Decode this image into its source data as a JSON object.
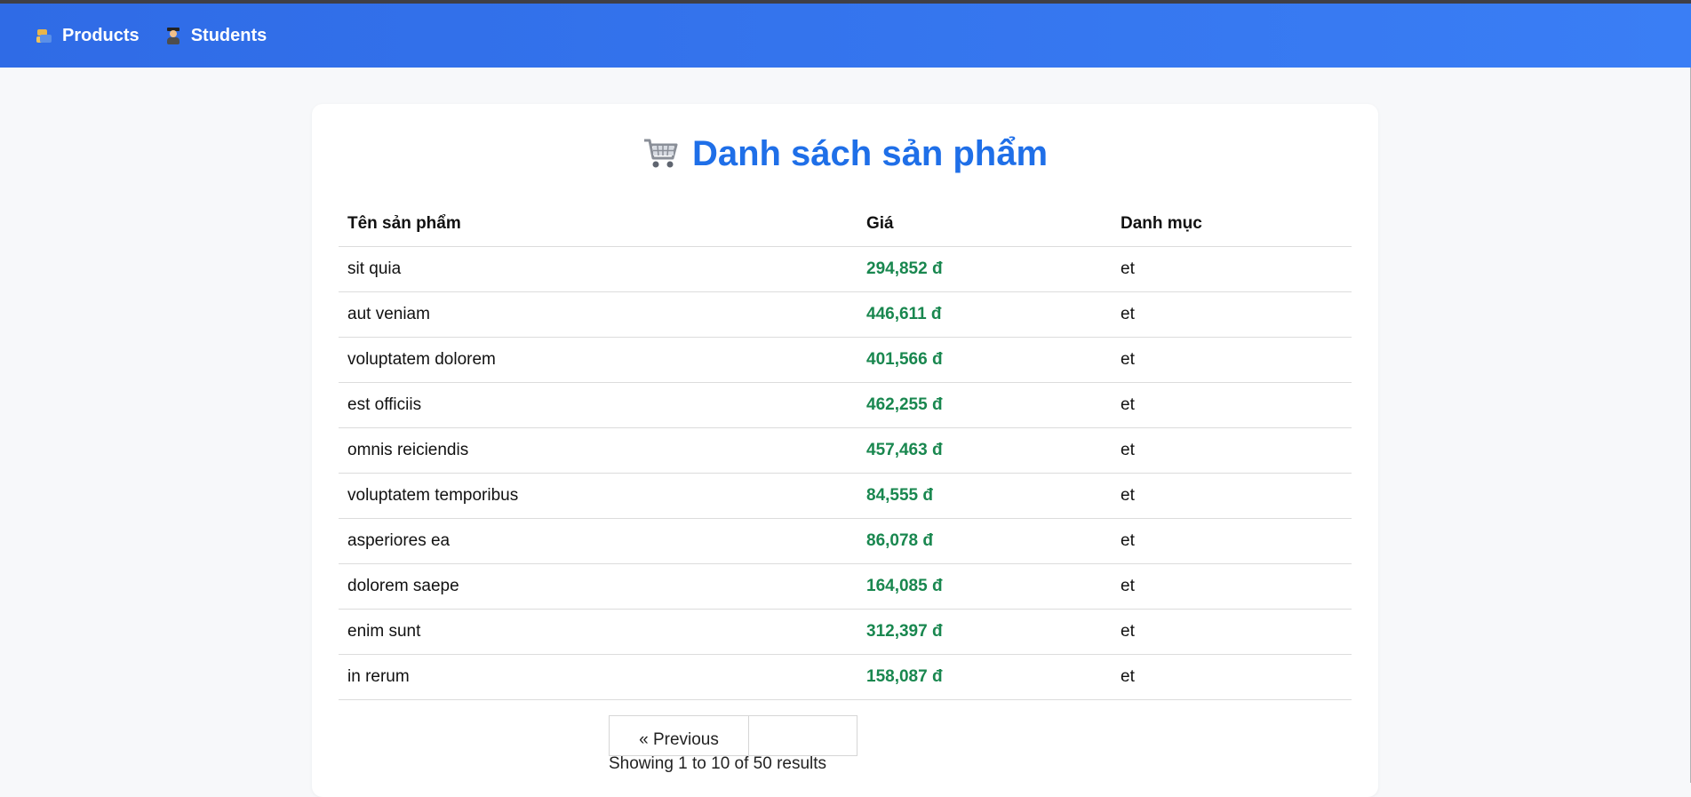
{
  "nav": {
    "items": [
      {
        "label": "Products",
        "icon": "products-icon"
      },
      {
        "label": "Students",
        "icon": "student-icon"
      }
    ]
  },
  "page": {
    "title": "Danh sách sản phẩm",
    "title_icon": "cart-icon",
    "title_color": "#1f6fe8",
    "price_color": "#19874f"
  },
  "table": {
    "headers": [
      "Tên sản phẩm",
      "Giá",
      "Danh mục"
    ],
    "rows": [
      {
        "name": "sit quia",
        "price": "294,852 đ",
        "category": "et"
      },
      {
        "name": "aut veniam",
        "price": "446,611 đ",
        "category": "et"
      },
      {
        "name": "voluptatem dolorem",
        "price": "401,566 đ",
        "category": "et"
      },
      {
        "name": "est officiis",
        "price": "462,255 đ",
        "category": "et"
      },
      {
        "name": "omnis reiciendis",
        "price": "457,463 đ",
        "category": "et"
      },
      {
        "name": "voluptatem temporibus",
        "price": "84,555 đ",
        "category": "et"
      },
      {
        "name": "asperiores ea",
        "price": "86,078 đ",
        "category": "et"
      },
      {
        "name": "dolorem saepe",
        "price": "164,085 đ",
        "category": "et"
      },
      {
        "name": "enim sunt",
        "price": "312,397 đ",
        "category": "et"
      },
      {
        "name": "in rerum",
        "price": "158,087 đ",
        "category": "et"
      }
    ]
  },
  "pagination": {
    "previous_label": "« Previous",
    "next_label": "",
    "results_text": "Showing 1 to 10 of 50 results"
  }
}
